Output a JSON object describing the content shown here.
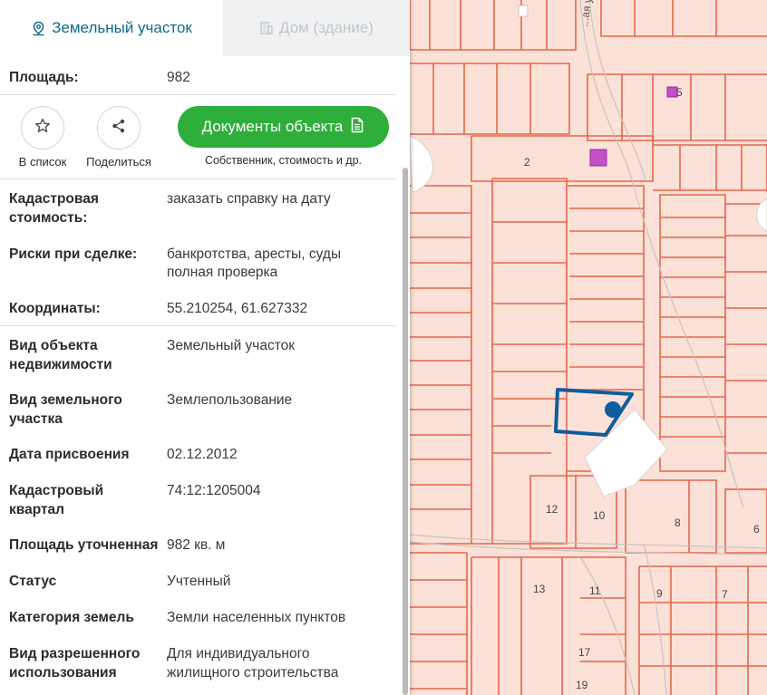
{
  "tabs": {
    "land": {
      "label": "Земельный участок",
      "icon": "map-pin-icon"
    },
    "house": {
      "label": "Дом (здание)",
      "icon": "building-icon"
    }
  },
  "area": {
    "label": "Площадь:",
    "value": "982"
  },
  "actions": {
    "favorite_label": "В список",
    "share_label": "Поделиться",
    "documents_label": "Документы объекта",
    "documents_sub": "Собственник, стоимость и др."
  },
  "cadastral_cost": {
    "label": "Кадастровая стоимость:",
    "link": "заказать справку на дату"
  },
  "risks": {
    "label": "Риски при сделке:",
    "value": "банкротства, аресты, суды",
    "link": "полная проверка"
  },
  "coordinates": {
    "label": "Координаты:",
    "value": "55.210254, 61.627332"
  },
  "details": [
    {
      "label": "Вид объекта недвижимости",
      "value": "Земельный участок"
    },
    {
      "label": "Вид земельного участка",
      "value": "Землепользование"
    },
    {
      "label": "Дата присвоения",
      "value": "02.12.2012"
    },
    {
      "label": "Кадастровый квартал",
      "value": "74:12:1205004"
    },
    {
      "label": "Площадь уточненная",
      "value": "982 кв. м"
    },
    {
      "label": "Статус",
      "value": "Учтенный"
    },
    {
      "label": "Категория земель",
      "value": "Земли населенных пунктов"
    },
    {
      "label": "Вид разрешенного использования",
      "value": "Для индивидуального жилищного строительства"
    }
  ],
  "map": {
    "street_label": "...ая ул.",
    "parcel_numbers": [
      "2",
      "5",
      "12",
      "10",
      "8",
      "6",
      "13",
      "11",
      "9",
      "7",
      "17",
      "19"
    ],
    "colors": {
      "background": "#fbe1d7",
      "parcel_border": "#e8664a",
      "selected_parcel": "#0e5d9c",
      "building": "#c24fc9",
      "accent": "#0e6b86",
      "button_green": "#2eae3a"
    }
  }
}
